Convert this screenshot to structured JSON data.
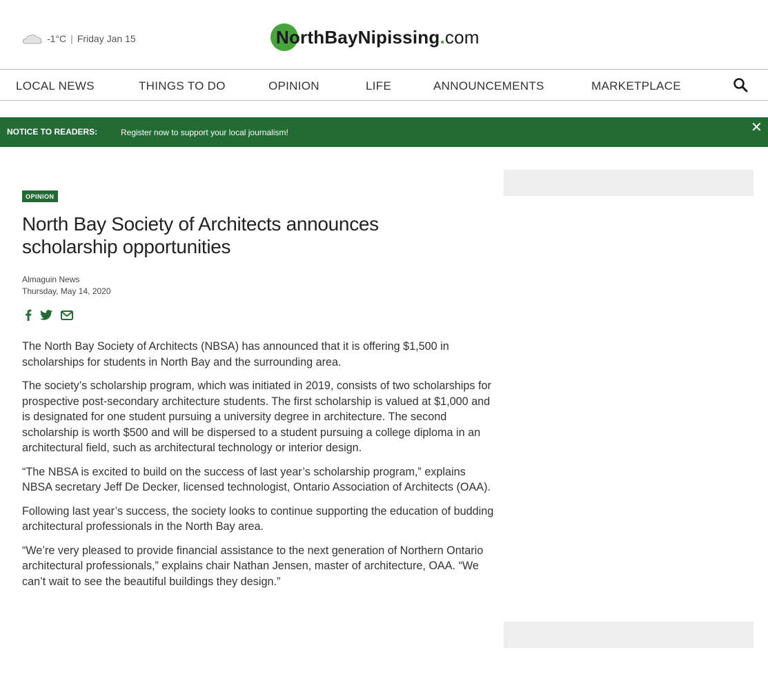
{
  "weather": {
    "temperature": "-1°C",
    "separator": "|",
    "date": "Friday Jan 15",
    "icon": "cloud-icon"
  },
  "logo": {
    "prefix": "NorthBayNipissing",
    "dot": ".",
    "suffix": "com",
    "brand_color": "#46a53a"
  },
  "nav": {
    "items": [
      "LOCAL NEWS",
      "THINGS TO DO",
      "OPINION",
      "LIFE",
      "ANNOUNCEMENTS",
      "MARKETPLACE"
    ],
    "search_icon": "search-icon"
  },
  "notice": {
    "label": "NOTICE TO READERS:",
    "message": "Register now to support your local journalism!",
    "close": "✕",
    "color": "#236b35"
  },
  "article": {
    "category": "OPINION",
    "headline": "North Bay Society of Architects announces scholarship opportunities",
    "author": "Almaguin News",
    "date": "Thursday, May 14, 2020",
    "share_icons": [
      "facebook-icon",
      "twitter-icon",
      "email-icon"
    ],
    "paragraphs": [
      "The North Bay Society of Architects (NBSA) has announced that it is offering $1,500 in scholarships for students in North Bay and the surrounding area.",
      "The society’s scholarship program, which was initiated in 2019, consists of two scholarships for prospective post-secondary architecture students. The first scholarship is valued at $1,000 and is designated for one student pursuing a university degree in architecture. The second scholarship is worth $500 and will be dispersed to a student pursuing a college diploma in an architectural field, such as architectural technology or interior design.",
      "“The NBSA is excited to build on the success of last year’s scholarship program,” explains NBSA secretary Jeff De Decker, licensed technologist, Ontario Association of Architects (OAA).",
      "Following last year’s success, the society looks to continue supporting the education of budding architectural professionals in the North Bay area.",
      "“We’re very pleased to provide financial assistance to the next generation of Northern Ontario architectural professionals,” explains chair Nathan Jensen, master of architecture, OAA. “We can’t wait to see the beautiful buildings they design.”"
    ]
  }
}
